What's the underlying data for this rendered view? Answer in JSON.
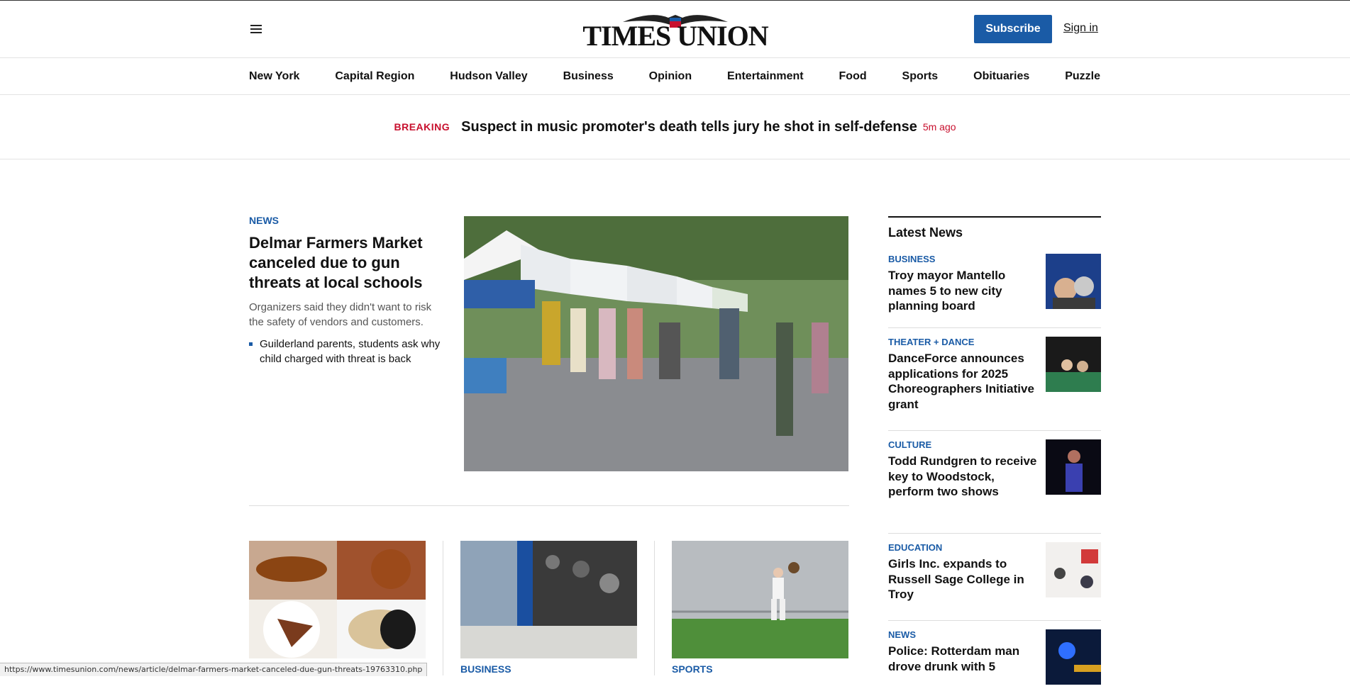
{
  "header": {
    "logo_text": "TIMES UNION",
    "subscribe_label": "Subscribe",
    "signin_label": "Sign in"
  },
  "nav": {
    "items": [
      "New York",
      "Capital Region",
      "Hudson Valley",
      "Business",
      "Opinion",
      "Entertainment",
      "Food",
      "Sports",
      "Obituaries",
      "Puzzle"
    ]
  },
  "breaking": {
    "label": "BREAKING",
    "headline": "Suspect in music promoter's death tells jury he shot in self-defense",
    "time": "5m ago"
  },
  "lead_story": {
    "kicker": "NEWS",
    "title": "Delmar Farmers Market canceled due to gun threats at local schools",
    "dek": "Organizers said they didn't want to risk the safety of vendors and customers.",
    "related": "Guilderland parents, students ask why child charged with threat is back"
  },
  "cards": [
    {
      "kicker": ""
    },
    {
      "kicker": "BUSINESS"
    },
    {
      "kicker": "SPORTS"
    }
  ],
  "sidebar": {
    "title": "Latest News",
    "items": [
      {
        "kicker": "BUSINESS",
        "headline": "Troy mayor Mantello names 5 to new city planning board"
      },
      {
        "kicker": "THEATER + DANCE",
        "headline": "DanceForce announces applications for 2025 Choreographers Initiative grant"
      },
      {
        "kicker": "CULTURE",
        "headline": "Todd Rundgren to receive key to Woodstock, perform two shows"
      },
      {
        "kicker": "EDUCATION",
        "headline": "Girls Inc. expands to Russell Sage College in Troy"
      },
      {
        "kicker": "NEWS",
        "headline": "Police: Rotterdam man drove drunk with 5"
      }
    ]
  },
  "status_url": "https://www.timesunion.com/news/article/delmar-farmers-market-canceled-due-gun-threats-19763310.php",
  "colors": {
    "accent": "#1a5ba6",
    "breaking": "#c8102e"
  }
}
